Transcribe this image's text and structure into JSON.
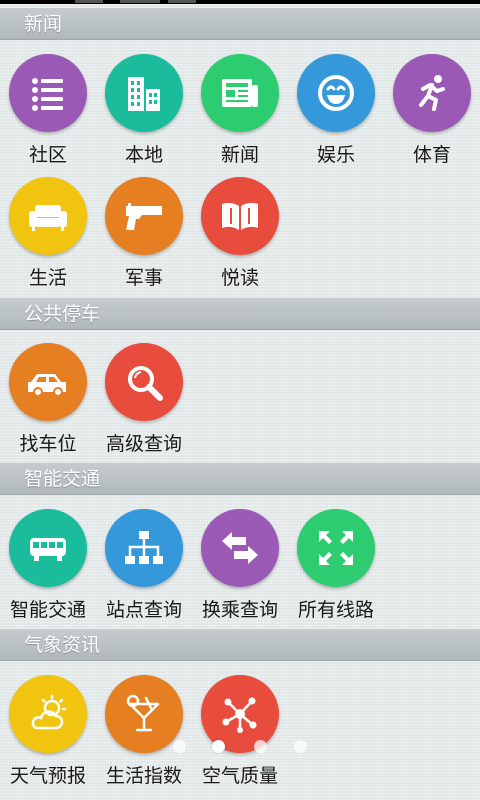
{
  "sections": [
    {
      "title": "新闻",
      "items": [
        {
          "label": "社区",
          "color": "#9b59b6",
          "icon": "list-icon"
        },
        {
          "label": "本地",
          "color": "#1abc9c",
          "icon": "buildings-icon"
        },
        {
          "label": "新闻",
          "color": "#2ecc71",
          "icon": "newspaper-icon"
        },
        {
          "label": "娱乐",
          "color": "#3498db",
          "icon": "smiley-icon"
        },
        {
          "label": "体育",
          "color": "#9b59b6",
          "icon": "runner-icon"
        },
        {
          "label": "生活",
          "color": "#f1c40f",
          "icon": "sofa-icon"
        },
        {
          "label": "军事",
          "color": "#e67e22",
          "icon": "pistol-icon"
        },
        {
          "label": "悦读",
          "color": "#e74c3c",
          "icon": "book-icon"
        }
      ]
    },
    {
      "title": "公共停车",
      "items": [
        {
          "label": "找车位",
          "color": "#e67e22",
          "icon": "car-icon"
        },
        {
          "label": "高级查询",
          "color": "#e74c3c",
          "icon": "magnifier-icon"
        }
      ]
    },
    {
      "title": "智能交通",
      "items": [
        {
          "label": "智能交通",
          "color": "#1abc9c",
          "icon": "bus-icon"
        },
        {
          "label": "站点查询",
          "color": "#3498db",
          "icon": "sitemap-icon"
        },
        {
          "label": "换乘查询",
          "color": "#9b59b6",
          "icon": "swap-arrows-icon"
        },
        {
          "label": "所有线路",
          "color": "#2ecc71",
          "icon": "expand-arrows-icon"
        }
      ]
    },
    {
      "title": "气象资讯",
      "items": [
        {
          "label": "天气预报",
          "color": "#f1c40f",
          "icon": "weather-icon"
        },
        {
          "label": "生活指数",
          "color": "#e67e22",
          "icon": "cocktail-icon"
        },
        {
          "label": "空气质量",
          "color": "#e74c3c",
          "icon": "molecule-icon"
        }
      ]
    }
  ],
  "pager": {
    "pages": 4,
    "active": 1
  }
}
